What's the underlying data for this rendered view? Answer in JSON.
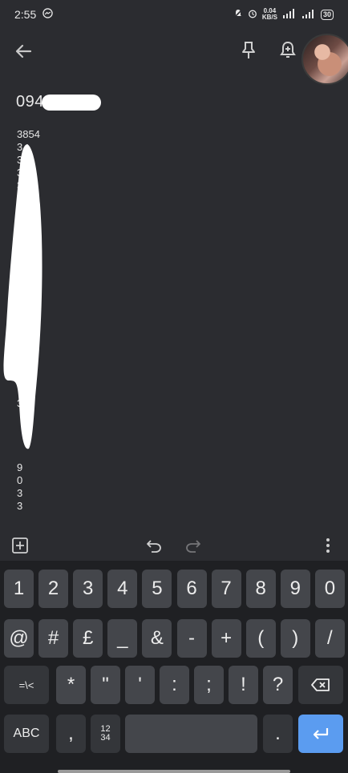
{
  "status_bar": {
    "time": "2:55",
    "net_speed_value": "0.04",
    "net_speed_unit": "KB/S",
    "signal1": "ᵒ",
    "battery": "30"
  },
  "icons": {
    "back": "arrow-left",
    "pin": "pin",
    "reminder": "bell-plus",
    "add": "square-plus",
    "undo": "undo",
    "redo": "redo",
    "more": "more-vertical"
  },
  "note": {
    "title": "094",
    "lines": [
      "3854",
      "3",
      "3",
      "3",
      "3",
      "",
      "",
      "",
      "",
      "",
      "",
      "",
      "",
      "",
      "",
      "",
      "",
      "",
      "",
      "",
      "",
      "3",
      "",
      "",
      "",
      "",
      "9",
      "0",
      "3",
      "3"
    ]
  },
  "keyboard": {
    "row1": [
      "1",
      "2",
      "3",
      "4",
      "5",
      "6",
      "7",
      "8",
      "9",
      "0"
    ],
    "row2": [
      "@",
      "#",
      "£",
      "_",
      "&",
      "-",
      "+",
      "(",
      ")",
      "/"
    ],
    "row3": [
      "=\\<",
      "*",
      "\"",
      "'",
      ":",
      ";",
      "!",
      "?"
    ],
    "row4": {
      "abc": "ABC",
      "comma": ",",
      "numpad_top": "12",
      "numpad_bottom": "34",
      "period": ".",
      "enter_icon": "enter-arrow"
    }
  },
  "colors": {
    "background": "#2b2c30",
    "keyboard": "#1f2023",
    "key": "#44464b",
    "enter": "#5b9cf0"
  }
}
